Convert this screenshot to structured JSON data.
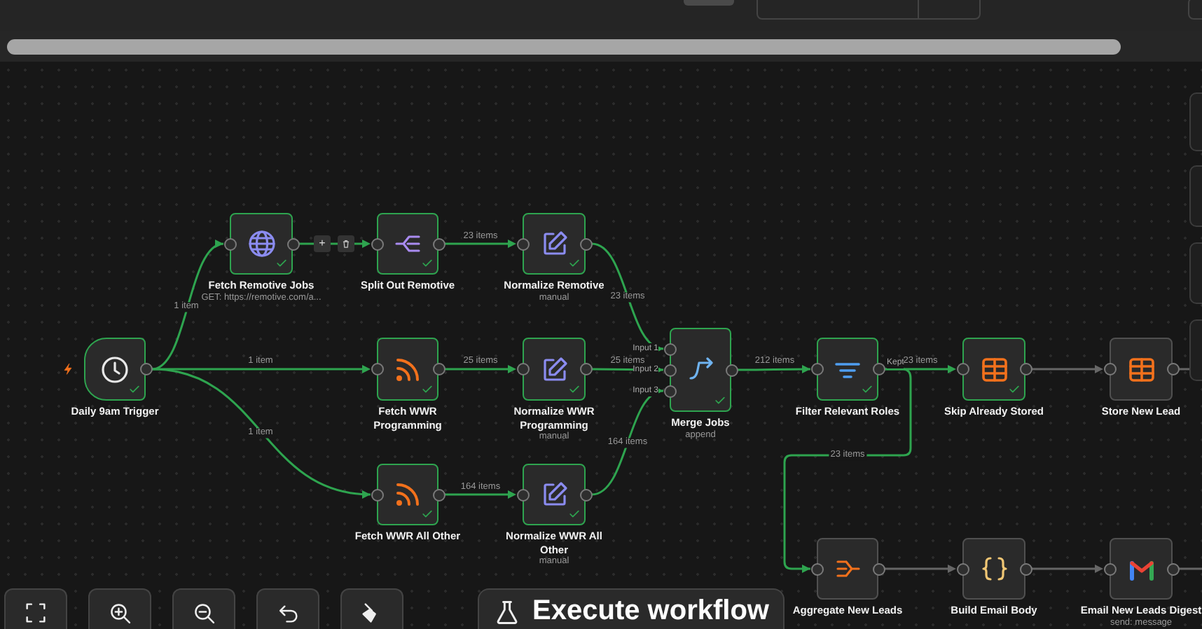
{
  "nodes": [
    {
      "kind": "trigger",
      "title": "Daily 9am Trigger",
      "executed": true
    },
    {
      "kind": "http",
      "title": "Fetch Remotive Jobs",
      "subtitle": "GET: https://remotive.com/a...",
      "executed": true
    },
    {
      "kind": "split",
      "title": "Split Out Remotive",
      "executed": true
    },
    {
      "kind": "set",
      "title": "Normalize Remotive",
      "subtitle": "manual",
      "executed": true
    },
    {
      "kind": "rss",
      "title": "Fetch WWR Programming",
      "executed": true
    },
    {
      "kind": "set",
      "title": "Normalize WWR Programming",
      "subtitle": "manual",
      "executed": true
    },
    {
      "kind": "rss",
      "title": "Fetch WWR All Other",
      "executed": true
    },
    {
      "kind": "set",
      "title": "Normalize WWR All Other",
      "subtitle": "manual",
      "executed": true
    },
    {
      "kind": "merge",
      "title": "Merge Jobs",
      "subtitle": "append",
      "inputs": [
        "Input 1",
        "Input 2",
        "Input 3"
      ],
      "executed": true
    },
    {
      "kind": "filter",
      "title": "Filter Relevant Roles",
      "outputs": [
        "Kept"
      ],
      "executed": true
    },
    {
      "kind": "table",
      "title": "Skip Already Stored",
      "executed": true
    },
    {
      "kind": "table",
      "title": "Store New Lead",
      "executed": false
    },
    {
      "kind": "aggregate",
      "title": "Aggregate New Leads",
      "executed": false
    },
    {
      "kind": "code",
      "title": "Build Email Body",
      "executed": false
    },
    {
      "kind": "gmail",
      "title": "Email New Leads Digest",
      "subtitle": "send: message",
      "executed": false
    }
  ],
  "edges": [
    {
      "label": "1 item",
      "executed": true
    },
    {
      "label": "1 item",
      "executed": true
    },
    {
      "label": "1 item",
      "executed": true
    },
    {
      "executed": true,
      "hovered": true
    },
    {
      "label": "23 items",
      "executed": true
    },
    {
      "label": "23 items",
      "executed": true
    },
    {
      "label": "25 items",
      "executed": true
    },
    {
      "label": "25 items",
      "executed": true
    },
    {
      "label": "164 items",
      "executed": true
    },
    {
      "label": "164 items",
      "executed": true
    },
    {
      "label": "212 items",
      "executed": true
    },
    {
      "label": "23 items",
      "executed": true
    },
    {
      "label": "23 items",
      "executed": true
    },
    {
      "executed": false
    },
    {
      "executed": false
    },
    {
      "executed": false
    },
    {
      "executed": false
    },
    {
      "executed": false
    }
  ],
  "edge_actions": {
    "add": "+"
  },
  "canvas_controls": [
    {
      "kind": "fit"
    },
    {
      "kind": "zoom_in"
    },
    {
      "kind": "zoom_out"
    },
    {
      "kind": "undo"
    },
    {
      "kind": "tidy"
    }
  ],
  "execute_button": {
    "label": "Execute workflow"
  }
}
